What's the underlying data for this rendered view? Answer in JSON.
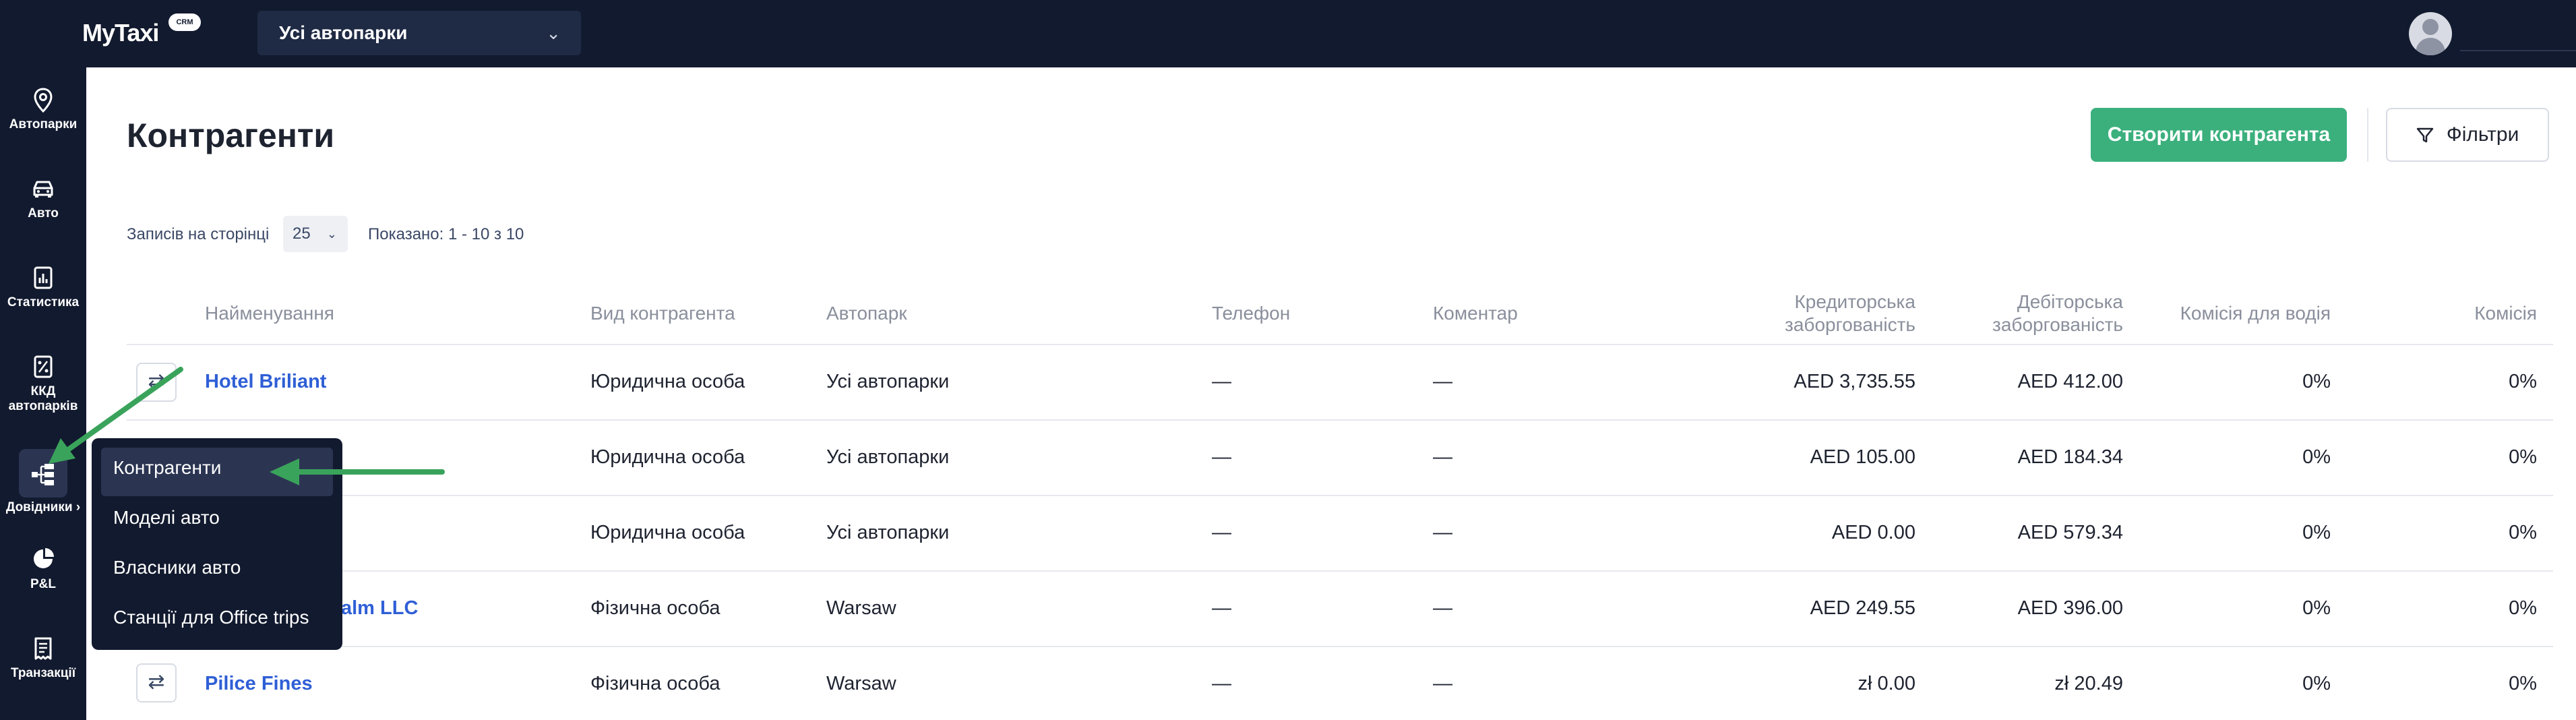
{
  "app": {
    "logo": "MyTaxi",
    "logo_badge": "CRM"
  },
  "topbar": {
    "fleet_select": "Усі автопарки"
  },
  "sidebar": {
    "items": [
      {
        "label": "Автопарки",
        "icon": "map-pin-icon"
      },
      {
        "label": "Авто",
        "icon": "car-icon"
      },
      {
        "label": "Статистика",
        "icon": "chart-icon"
      },
      {
        "label": "ККД автопарків",
        "icon": "percent-doc-icon"
      },
      {
        "label": "Довідники",
        "icon": "hierarchy-icon"
      },
      {
        "label": "P&L",
        "icon": "pie-chart-icon"
      },
      {
        "label": "Транзакції",
        "icon": "receipt-icon"
      }
    ]
  },
  "flyout": {
    "items": [
      {
        "label": "Контрагенти",
        "active": true
      },
      {
        "label": "Моделі авто",
        "active": false
      },
      {
        "label": "Власники авто",
        "active": false
      },
      {
        "label": "Станції для Office trips",
        "active": false
      }
    ]
  },
  "page": {
    "title": "Контрагенти",
    "create_button": "Створити контрагента",
    "filter_button": "Фільтри"
  },
  "pagination": {
    "per_page_label": "Записів на сторінці",
    "per_page_value": "25",
    "shown": "Показано: 1 - 10 з 10"
  },
  "table": {
    "headers": {
      "name": "Найменування",
      "type": "Вид контрагента",
      "fleet": "Автопарк",
      "phone": "Телефон",
      "comment": "Коментар",
      "credit_1": "Кредиторська",
      "credit_2": "заборгованість",
      "debit_1": "Дебіторська",
      "debit_2": "заборгованість",
      "driver_fee": "Комісія для водія",
      "fee": "Комісія"
    },
    "rows": [
      {
        "name": "Hotel Briliant",
        "type": "Юридична особа",
        "fleet": "Усі автопарки",
        "phone": "—",
        "comment": "—",
        "credit": "AED 3,735.55",
        "debit": "AED 412.00",
        "driver_fee": "0%",
        "fee": "0%"
      },
      {
        "name": "",
        "type": "Юридична особа",
        "fleet": "Усі автопарки",
        "phone": "—",
        "comment": "—",
        "credit": "AED 105.00",
        "debit": "AED 184.34",
        "driver_fee": "0%",
        "fee": "0%"
      },
      {
        "name": "",
        "type": "Юридична особа",
        "fleet": "Усі автопарки",
        "phone": "—",
        "comment": "—",
        "credit": "AED 0.00",
        "debit": "AED 579.34",
        "driver_fee": "0%",
        "fee": "0%"
      },
      {
        "name": "alm LLC",
        "type": "Фізична особа",
        "fleet": "Warsaw",
        "phone": "—",
        "comment": "—",
        "credit": "AED 249.55",
        "debit": "AED 396.00",
        "driver_fee": "0%",
        "fee": "0%"
      },
      {
        "name": "Pilice Fines",
        "type": "Фізична особа",
        "fleet": "Warsaw",
        "phone": "—",
        "comment": "—",
        "credit": "zł 0.00",
        "debit": "zł 20.49",
        "driver_fee": "0%",
        "fee": "0%"
      }
    ]
  },
  "colors": {
    "nav_bg": "#121a2f",
    "accent_green": "#3bb07d",
    "link_blue": "#2f5fd6",
    "annotation_arrow": "#3aa35b"
  }
}
